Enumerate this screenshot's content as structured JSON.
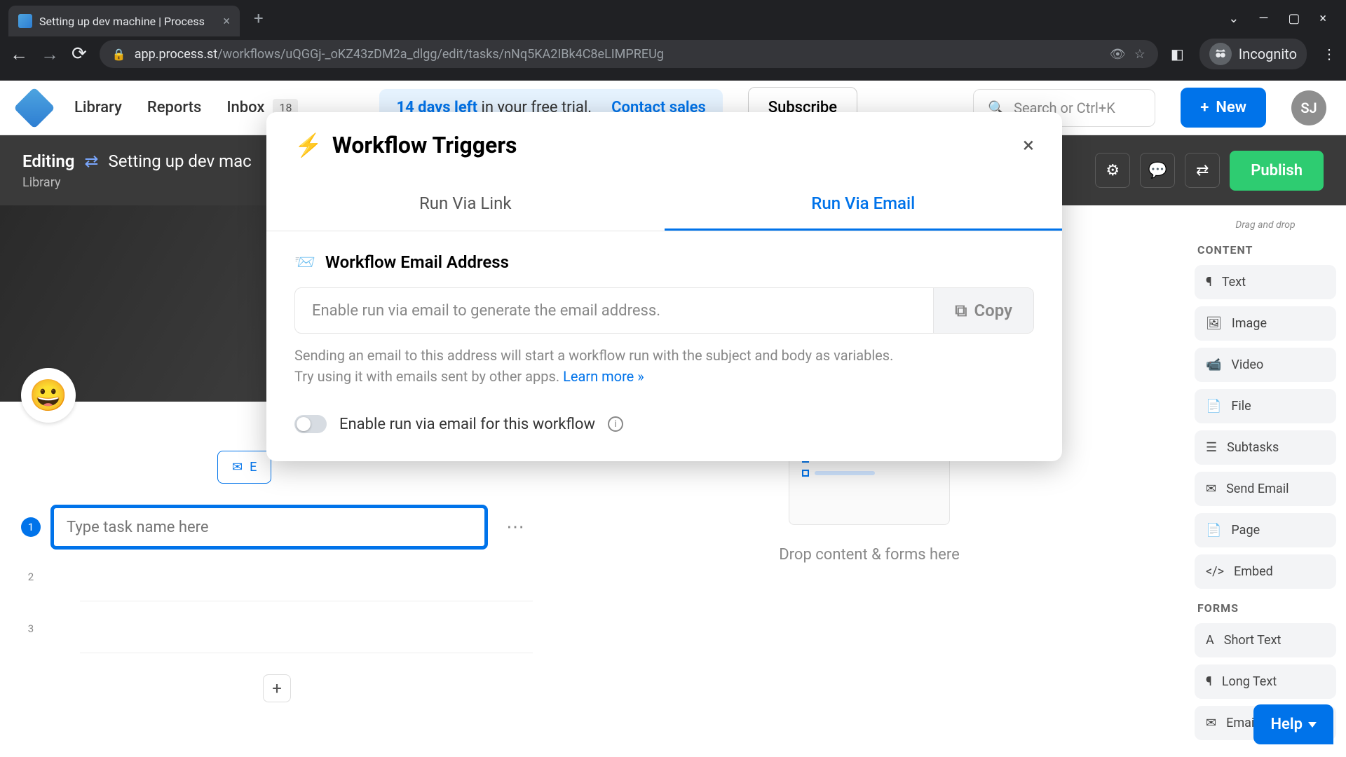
{
  "browser": {
    "tab_title": "Setting up dev machine | Process",
    "url_domain": "app.process.st",
    "url_path": "/workflows/uQGGj-_oKZ43zDM2a_dlgg/edit/tasks/nNq5KA2IBk4C8eLIMPREUg",
    "incognito_label": "Incognito"
  },
  "nav": {
    "library": "Library",
    "reports": "Reports",
    "inbox": "Inbox",
    "inbox_count": "18",
    "trial_days": "14 days left",
    "trial_rest": " in your free trial.",
    "contact": "Contact sales",
    "subscribe": "Subscribe",
    "search_placeholder": "Search or Ctrl+K",
    "new": "New",
    "user_initials": "SJ"
  },
  "editor": {
    "editing": "Editing",
    "workflow_name": "Setting up dev mac",
    "breadcrumb": "Library",
    "publish": "Publish"
  },
  "tasks": {
    "placeholder": "Type task name here",
    "num1": "1",
    "num2": "2",
    "num3": "3"
  },
  "center": {
    "drop_text": "Drop content & forms here"
  },
  "panel": {
    "hint": "Drag and drop",
    "content_heading": "CONTENT",
    "forms_heading": "FORMS",
    "widgets": {
      "text": "Text",
      "image": "Image",
      "video": "Video",
      "file": "File",
      "subtasks": "Subtasks",
      "send_email": "Send Email",
      "page": "Page",
      "embed": "Embed",
      "short_text": "Short Text",
      "long_text": "Long Text",
      "email": "Email"
    }
  },
  "modal": {
    "title": "Workflow Triggers",
    "tab_link": "Run Via Link",
    "tab_email": "Run Via Email",
    "section": "Workflow Email Address",
    "field_text": "Enable run via email to generate the email address.",
    "copy": "Copy",
    "helper1": "Sending an email to this address will start a workflow run with the subject and body as variables.",
    "helper2": "Try using it with emails sent by other apps. ",
    "learn_more": "Learn more »",
    "toggle_label": "Enable run via email for this workflow"
  },
  "help": "Help"
}
